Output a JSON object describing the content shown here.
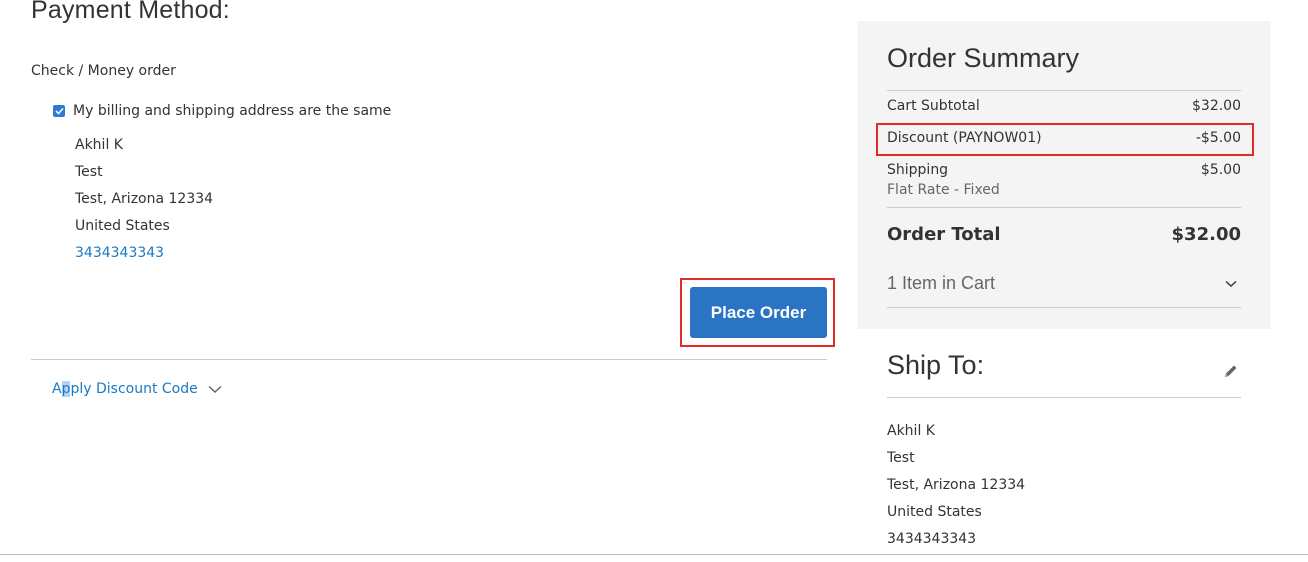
{
  "payment": {
    "title": "Payment Method:",
    "method": "Check / Money order",
    "same_address_label": "My billing and shipping address are the same",
    "same_address_checked": true,
    "billing_address": {
      "name": "Akhil K",
      "street": "Test",
      "city_region_zip": "Test, Arizona 12334",
      "country": "United States",
      "phone": "3434343343"
    },
    "place_order_label": "Place Order",
    "discount_toggle": {
      "label_highlighted_prefix": "A",
      "label_highlighted": "p",
      "label_rest": "ply Discount Code"
    }
  },
  "summary": {
    "title": "Order Summary",
    "rows": [
      {
        "label": "Cart Subtotal",
        "value": "$32.00"
      },
      {
        "label": "Discount (PAYNOW01)",
        "value": "-$5.00"
      },
      {
        "label": "Shipping",
        "sublabel": "Flat Rate - Fixed",
        "value": "$5.00"
      }
    ],
    "total_label": "Order Total",
    "total_value": "$32.00",
    "items_in_cart": "1 Item in Cart"
  },
  "ship_to": {
    "title": "Ship To:",
    "address": {
      "name": "Akhil K",
      "street": "Test",
      "city_region_zip": "Test, Arizona 12334",
      "country": "United States",
      "phone": "3434343343"
    }
  },
  "colors": {
    "accent": "#1979c3",
    "button": "#2b74c4",
    "highlight_frame": "#e02b27",
    "summary_bg": "#f4f4f4"
  }
}
